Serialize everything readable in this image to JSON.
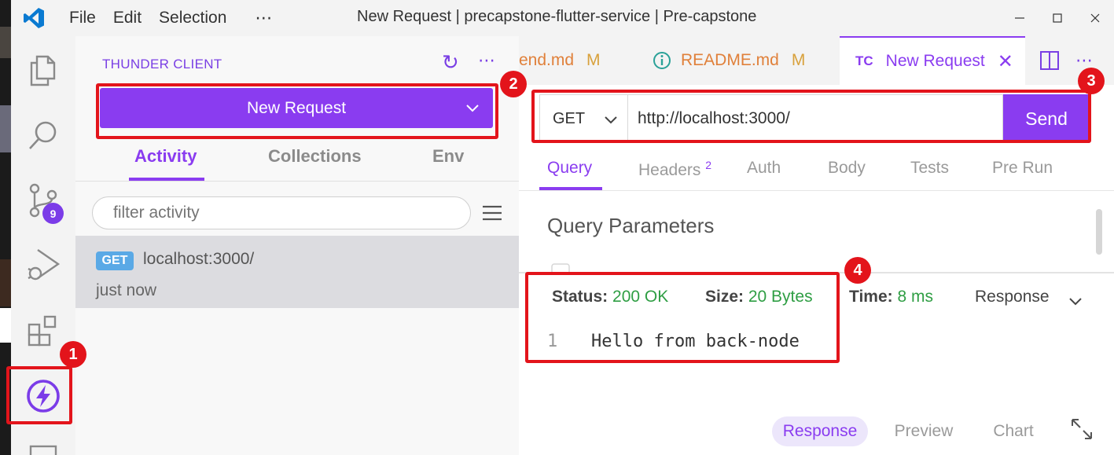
{
  "window": {
    "menu": [
      "File",
      "Edit",
      "Selection"
    ],
    "more": "⋯",
    "title": "New Request | precapstone-flutter-service | Pre-capstone"
  },
  "activitybar": {
    "icons": [
      "explorer-icon",
      "search-icon",
      "source-control-icon",
      "run-debug-icon",
      "extensions-icon",
      "thunder-client-icon"
    ],
    "scm_badge": "9"
  },
  "sidebar": {
    "title": "THUNDER CLIENT",
    "new_request_label": "New Request",
    "tabs": [
      "Activity",
      "Collections",
      "Env"
    ],
    "active_tab": "Activity",
    "filter_placeholder": "filter activity",
    "activity": [
      {
        "method": "GET",
        "url": "localhost:3000/",
        "time": "just now"
      }
    ]
  },
  "editor": {
    "tabs": [
      {
        "name": "end.md",
        "flag": "M"
      },
      {
        "name": "README.md",
        "flag": "M"
      },
      {
        "prefix": "TC",
        "name": "New Request",
        "active": true
      }
    ],
    "method": "GET",
    "url": "http://localhost:3000/",
    "send_label": "Send",
    "request_tabs": [
      "Query",
      "Headers",
      "Auth",
      "Body",
      "Tests",
      "Pre Run"
    ],
    "headers_count": "2",
    "query_title": "Query Parameters",
    "response": {
      "status_label": "Status:",
      "status_value": "200 OK",
      "size_label": "Size:",
      "size_value": "20 Bytes",
      "time_label": "Time:",
      "time_value": "8 ms",
      "view_select": "Response",
      "line_number": "1",
      "body": "Hello from back-node"
    },
    "bottom_tabs": [
      "Response",
      "Preview",
      "Chart"
    ]
  },
  "annotations": [
    "1",
    "2",
    "3",
    "4"
  ],
  "colors": {
    "accent": "#8a3cf0",
    "annotation": "#e3141b",
    "success": "#2f9e44",
    "modified": "#e0803a",
    "get_badge": "#5aa9e6"
  }
}
